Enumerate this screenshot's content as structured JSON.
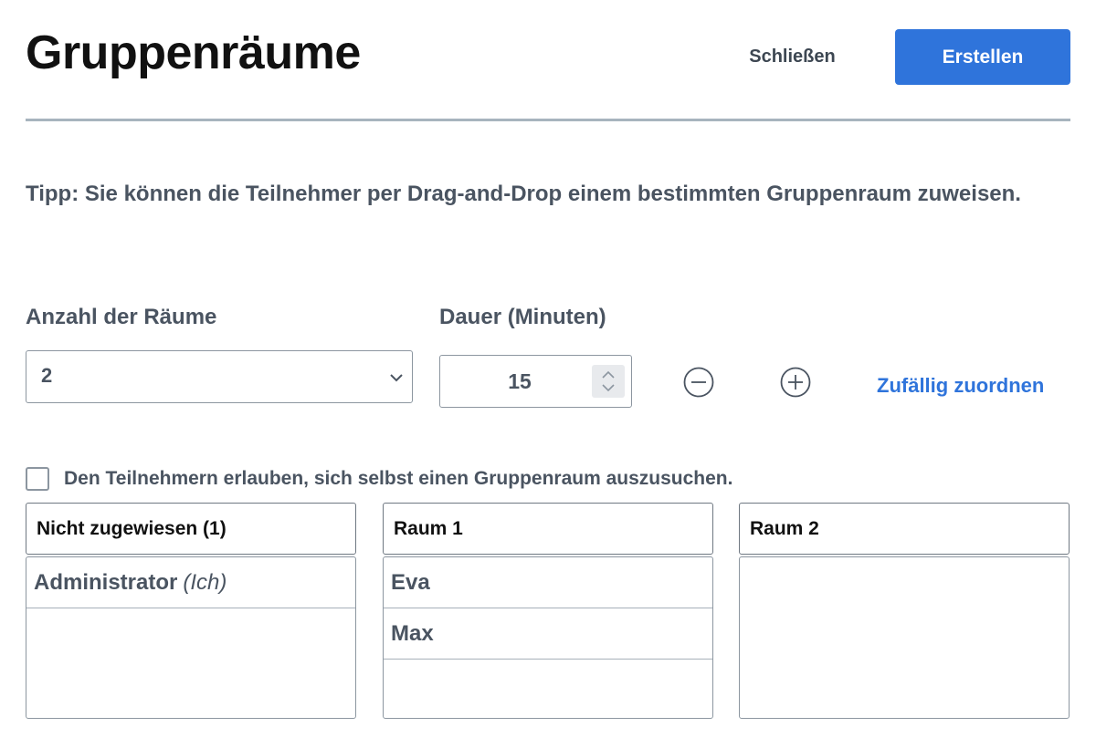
{
  "header": {
    "title": "Gruppenräume",
    "close_label": "Schließen",
    "create_label": "Erstellen"
  },
  "tip": "Tipp: Sie können die Teilnehmer per Drag-and-Drop einem bestimmten Gruppenraum zuweisen.",
  "rooms_count": {
    "label": "Anzahl der Räume",
    "value": "2"
  },
  "duration": {
    "label": "Dauer (Minuten)",
    "value": "15"
  },
  "random_assign_label": "Zufällig zuordnen",
  "allow_choose": {
    "label": "Den Teilnehmern erlauben, sich selbst einen Gruppenraum auszusuchen.",
    "checked": false
  },
  "columns": [
    {
      "header": "Nicht zugewiesen (1)",
      "participants": [
        {
          "name": "Administrator",
          "suffix": "(Ich)"
        }
      ]
    },
    {
      "header": "Raum 1",
      "participants": [
        {
          "name": "Eva",
          "suffix": ""
        },
        {
          "name": "Max",
          "suffix": ""
        }
      ]
    },
    {
      "header": "Raum 2",
      "participants": []
    }
  ],
  "colors": {
    "accent": "#2f74db",
    "text": "#4a5461",
    "divider": "#a7b4be"
  },
  "icons": {
    "chevron": "chevron-down-icon",
    "spinner": "number-spinner-icon",
    "minus": "minus-circle-icon",
    "plus": "plus-circle-icon"
  }
}
